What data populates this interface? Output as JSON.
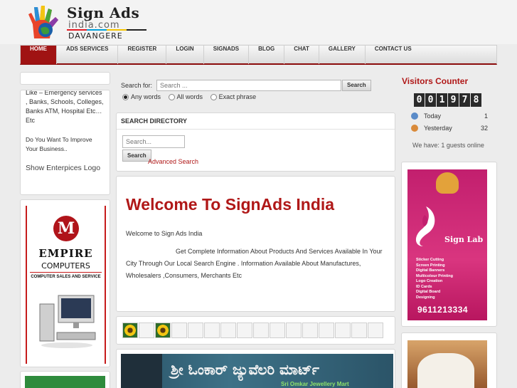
{
  "logo": {
    "main": "Sign Ads",
    "sub": "india.com",
    "city": "DAVANGERE"
  },
  "nav": [
    "HOME",
    "ADS SERVICES",
    "REGISTER",
    "LOGIN",
    "SIGNADS",
    "BLOG",
    "CHAT",
    "GALLERY",
    "CONTACT US"
  ],
  "left": {
    "cut_text": "Like – Emergency services , Banks, Schools, Colleges, Banks ATM, Hospital Etc…Etc",
    "improve": "Do You Want To Improve Your Business..",
    "show_logo": "Show Enterpices Logo",
    "ad": {
      "name": "EMPIRE",
      "sub": "COMPUTERS",
      "tag": "COMPUTER SALES AND SERVICE"
    }
  },
  "search": {
    "label": "Search for:",
    "placeholder": "Search ...",
    "button": "Search",
    "options": [
      "Any words",
      "All words",
      "Exact phrase"
    ]
  },
  "directory": {
    "title": "SEARCH DIRECTORY",
    "placeholder": "Search...",
    "button": "Search",
    "advanced": "Advanced Search"
  },
  "welcome": {
    "heading": "Welcome To SignAds India",
    "intro": "Welcome to Sign Ads India",
    "body": "Get Complete Information About Products And Services Available In Your City Through Our Local Search Engine . Information Available About Manufactures, Wholesalers ,Consumers, Merchants Etc"
  },
  "banner": {
    "text": "ಶ್ರೀ ಓಂಕಾರ್ ಜ್ಯುವೆಲರಿ ಮಾರ್ಟ್",
    "small": "Sri Omkar Jewellery Mart"
  },
  "visitors": {
    "title": "Visitors Counter",
    "counter": "001978",
    "rows": [
      {
        "label": "Today",
        "value": "1"
      },
      {
        "label": "Yesterday",
        "value": "32"
      }
    ],
    "online": "We have: 1 guests online"
  },
  "right_ad": {
    "brand": "Sign Lab",
    "services": [
      "Sticker Cutting",
      "Screen Printing",
      "Digital Banners",
      "Multicolour Printing",
      "Logo Creation",
      "ID Cards",
      "Digital Board",
      "Designing"
    ],
    "phone": "9611213334"
  },
  "colors": {
    "accent": "#a01313",
    "heading_red": "#b01818",
    "link": "#b01818"
  }
}
